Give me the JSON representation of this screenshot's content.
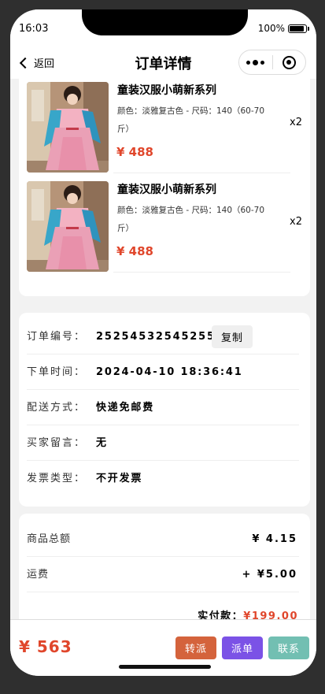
{
  "status_bar": {
    "time": "16:03",
    "battery": "100%"
  },
  "nav": {
    "back_label": "返回",
    "title": "订单详情"
  },
  "products": [
    {
      "name": "童装汉服小萌新系列",
      "spec": "颜色：淡雅复古色 - 尺码：140（60-70斤）",
      "price": "¥ 488",
      "qty": "x2"
    },
    {
      "name": "童装汉服小萌新系列",
      "spec": "颜色：淡雅复古色 - 尺码：140（60-70斤）",
      "price": "¥ 488",
      "qty": "x2"
    }
  ],
  "order": {
    "no_label": "订单编号：",
    "no_value": "25254532545255",
    "copy_label": "复制",
    "time_label": "下单时间：",
    "time_value": "2024-04-10 18:36:41",
    "ship_label": "配送方式：",
    "ship_value": "快递免邮费",
    "msg_label": "买家留言：",
    "msg_value": "无",
    "invoice_label": "发票类型：",
    "invoice_value": "不开发票"
  },
  "summary": {
    "goods_label": "商品总额",
    "goods_value": "¥ 4.15",
    "freight_label": "运费",
    "freight_value": "+ ¥5.00",
    "paid_label": "实付款：",
    "paid_value": "¥199.00"
  },
  "bottom": {
    "price": "¥ 563",
    "transfer_label": "转派",
    "dispatch_label": "派单",
    "contact_label": "联系"
  },
  "colors": {
    "accent": "#e0462b",
    "transfer": "#d4633c",
    "dispatch": "#7b52e6",
    "contact": "#72bfb2"
  }
}
